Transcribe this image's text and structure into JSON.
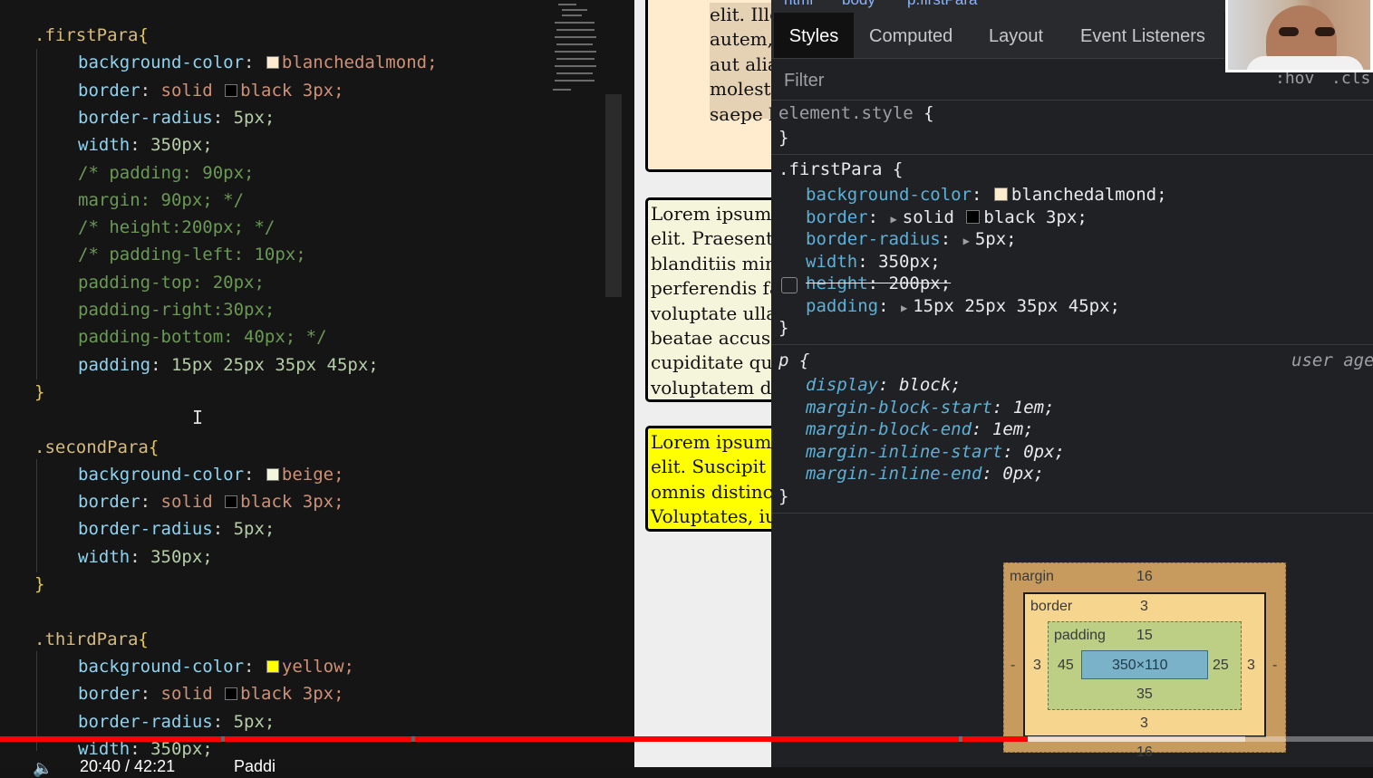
{
  "editor": {
    "first": {
      "selector": ".firstPara",
      "lines": [
        {
          "prop": "background-color",
          "swatch": "#ffebcd",
          "value": "blanchedalmond;"
        },
        {
          "prop": "border",
          "kw": "solid ",
          "swatch": "#000000",
          "value": "black 3px;"
        },
        {
          "prop": "border-radius",
          "value": "5px;"
        },
        {
          "prop": "width",
          "value": "350px;"
        }
      ],
      "comments": [
        "/* padding: 90px;",
        "margin: 90px; */",
        "/* height:200px; */",
        "/* padding-left: 10px;",
        "padding-top: 20px;",
        "padding-right:30px;",
        "padding-bottom: 40px; */"
      ],
      "padding": {
        "prop": "padding",
        "value": "15px 25px 35px 45px;"
      }
    },
    "second": {
      "selector": ".secondPara",
      "lines": [
        {
          "prop": "background-color",
          "swatch": "#f5f5dc",
          "value": "beige;"
        },
        {
          "prop": "border",
          "kw": "solid ",
          "swatch": "#000000",
          "value": "black 3px;"
        },
        {
          "prop": "border-radius",
          "value": "5px;"
        },
        {
          "prop": "width",
          "value": "350px;"
        }
      ]
    },
    "third": {
      "selector": ".thirdPara",
      "lines": [
        {
          "prop": "background-color",
          "swatch": "#ffff00",
          "value": "yellow;"
        },
        {
          "prop": "border",
          "kw": "solid ",
          "swatch": "#000000",
          "value": "black 3px;"
        },
        {
          "prop": "border-radius",
          "value": "5px;"
        },
        {
          "prop": "width",
          "value": "350px;"
        }
      ]
    }
  },
  "preview": {
    "box1": {
      "bg": "#ffebcd",
      "lines": [
        "elit. Illo",
        "autem,",
        "aut alias",
        "molestias",
        "saepe la"
      ]
    },
    "box2": {
      "bg": "#f5f5dc",
      "lines": [
        "Lorem ipsum",
        "elit. Praesentium",
        "blanditiis minus",
        "perferendis facere",
        "voluptate ullam",
        "beatae accusamus",
        "cupiditate quia",
        "voluptatem debitis"
      ]
    },
    "box3": {
      "bg": "#ffff00",
      "lines": [
        "Lorem ipsum",
        "elit. Suscipit t",
        "omnis distinctio",
        "Voluptates, iure"
      ]
    }
  },
  "devtools": {
    "breadcrumbs": [
      "html",
      "body",
      "p.firstPara"
    ],
    "tabs": [
      "Styles",
      "Computed",
      "Layout",
      "Event Listeners"
    ],
    "filter_placeholder": "Filter",
    "hov": ":hov",
    "cls": ".cls",
    "element_style": "element.style",
    "open_brace": "{",
    "close_brace": "}",
    "rule_selector": ".firstPara",
    "rule_props": [
      {
        "prop": "background-color",
        "swatch": "#ffebcd",
        "value": "blanchedalmond;"
      },
      {
        "prop": "border",
        "tri": true,
        "kw": "solid ",
        "swatch": "#000000",
        "value": "black 3px;"
      },
      {
        "prop": "border-radius",
        "tri": true,
        "value": "5px;"
      },
      {
        "prop": "width",
        "value": "350px;"
      },
      {
        "prop": "height",
        "value": "200px;",
        "strike": true
      },
      {
        "prop": "padding",
        "tri": true,
        "value": "15px 25px 35px 45px;"
      }
    ],
    "ua_selector": "p",
    "ua_label": "user age",
    "ua_props": [
      {
        "prop": "display",
        "value": "block;"
      },
      {
        "prop": "margin-block-start",
        "value": "1em;"
      },
      {
        "prop": "margin-block-end",
        "value": "1em;"
      },
      {
        "prop": "margin-inline-start",
        "value": "0px;"
      },
      {
        "prop": "margin-inline-end",
        "value": "0px;"
      }
    ],
    "box_model": {
      "margin_label": "margin",
      "margin_top": "16",
      "margin_left": "-",
      "margin_right": "-",
      "margin_bottom": "16",
      "border_label": "border",
      "border_top": "3",
      "border_left": "3",
      "border_right": "3",
      "border_bottom": "3",
      "padding_label": "padding",
      "padding_top": "15",
      "padding_left": "45",
      "padding_right": "25",
      "padding_bottom": "35",
      "content": "350×110"
    }
  },
  "player": {
    "time": "20:40 / 42:21",
    "chapter": "Paddi"
  },
  "colors": {
    "editor_bg": "#151515",
    "devtools_bg": "#202124",
    "progress_red": "#ff0000"
  }
}
